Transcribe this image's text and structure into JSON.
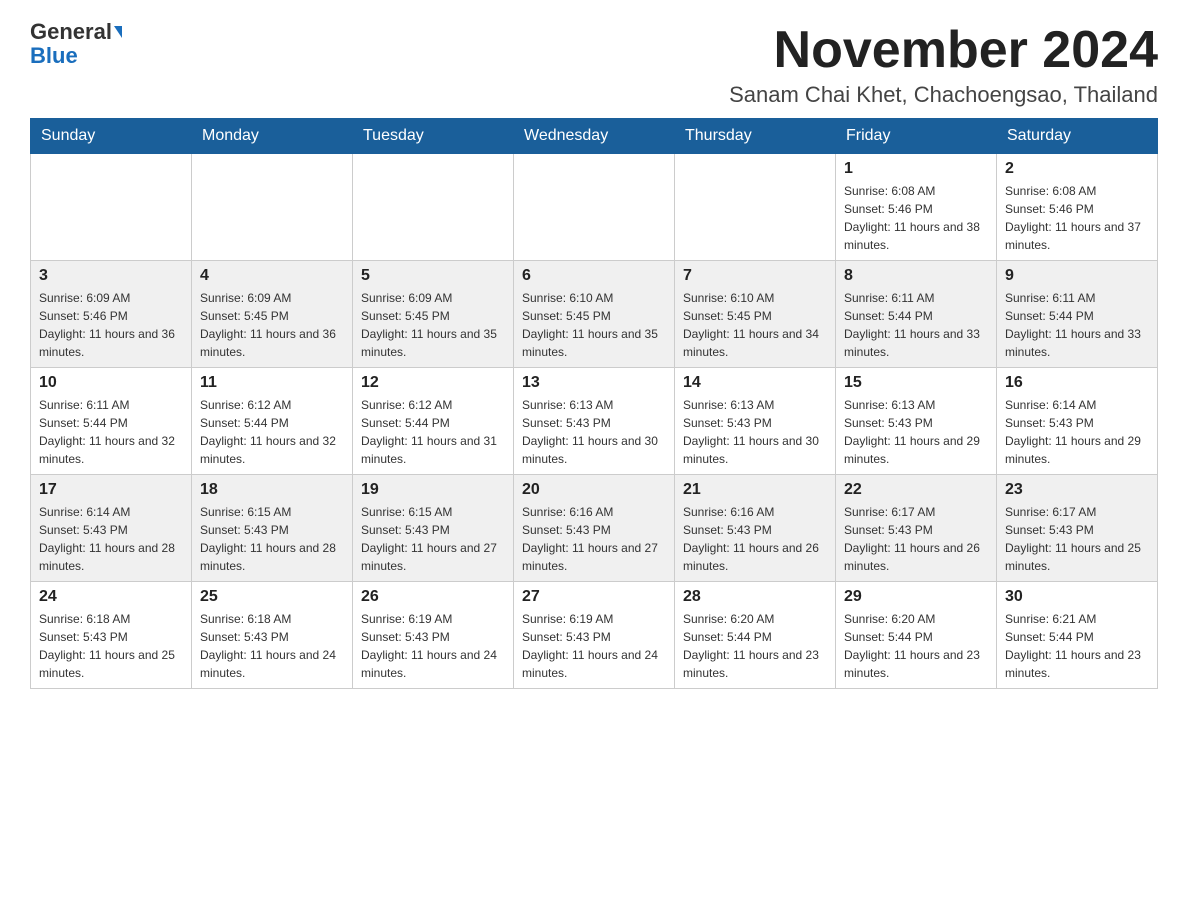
{
  "header": {
    "logo_general": "General",
    "logo_blue": "Blue",
    "month_title": "November 2024",
    "location": "Sanam Chai Khet, Chachoengsao, Thailand"
  },
  "days_of_week": [
    "Sunday",
    "Monday",
    "Tuesday",
    "Wednesday",
    "Thursday",
    "Friday",
    "Saturday"
  ],
  "weeks": [
    [
      {
        "day": "",
        "info": ""
      },
      {
        "day": "",
        "info": ""
      },
      {
        "day": "",
        "info": ""
      },
      {
        "day": "",
        "info": ""
      },
      {
        "day": "",
        "info": ""
      },
      {
        "day": "1",
        "info": "Sunrise: 6:08 AM\nSunset: 5:46 PM\nDaylight: 11 hours and 38 minutes."
      },
      {
        "day": "2",
        "info": "Sunrise: 6:08 AM\nSunset: 5:46 PM\nDaylight: 11 hours and 37 minutes."
      }
    ],
    [
      {
        "day": "3",
        "info": "Sunrise: 6:09 AM\nSunset: 5:46 PM\nDaylight: 11 hours and 36 minutes."
      },
      {
        "day": "4",
        "info": "Sunrise: 6:09 AM\nSunset: 5:45 PM\nDaylight: 11 hours and 36 minutes."
      },
      {
        "day": "5",
        "info": "Sunrise: 6:09 AM\nSunset: 5:45 PM\nDaylight: 11 hours and 35 minutes."
      },
      {
        "day": "6",
        "info": "Sunrise: 6:10 AM\nSunset: 5:45 PM\nDaylight: 11 hours and 35 minutes."
      },
      {
        "day": "7",
        "info": "Sunrise: 6:10 AM\nSunset: 5:45 PM\nDaylight: 11 hours and 34 minutes."
      },
      {
        "day": "8",
        "info": "Sunrise: 6:11 AM\nSunset: 5:44 PM\nDaylight: 11 hours and 33 minutes."
      },
      {
        "day": "9",
        "info": "Sunrise: 6:11 AM\nSunset: 5:44 PM\nDaylight: 11 hours and 33 minutes."
      }
    ],
    [
      {
        "day": "10",
        "info": "Sunrise: 6:11 AM\nSunset: 5:44 PM\nDaylight: 11 hours and 32 minutes."
      },
      {
        "day": "11",
        "info": "Sunrise: 6:12 AM\nSunset: 5:44 PM\nDaylight: 11 hours and 32 minutes."
      },
      {
        "day": "12",
        "info": "Sunrise: 6:12 AM\nSunset: 5:44 PM\nDaylight: 11 hours and 31 minutes."
      },
      {
        "day": "13",
        "info": "Sunrise: 6:13 AM\nSunset: 5:43 PM\nDaylight: 11 hours and 30 minutes."
      },
      {
        "day": "14",
        "info": "Sunrise: 6:13 AM\nSunset: 5:43 PM\nDaylight: 11 hours and 30 minutes."
      },
      {
        "day": "15",
        "info": "Sunrise: 6:13 AM\nSunset: 5:43 PM\nDaylight: 11 hours and 29 minutes."
      },
      {
        "day": "16",
        "info": "Sunrise: 6:14 AM\nSunset: 5:43 PM\nDaylight: 11 hours and 29 minutes."
      }
    ],
    [
      {
        "day": "17",
        "info": "Sunrise: 6:14 AM\nSunset: 5:43 PM\nDaylight: 11 hours and 28 minutes."
      },
      {
        "day": "18",
        "info": "Sunrise: 6:15 AM\nSunset: 5:43 PM\nDaylight: 11 hours and 28 minutes."
      },
      {
        "day": "19",
        "info": "Sunrise: 6:15 AM\nSunset: 5:43 PM\nDaylight: 11 hours and 27 minutes."
      },
      {
        "day": "20",
        "info": "Sunrise: 6:16 AM\nSunset: 5:43 PM\nDaylight: 11 hours and 27 minutes."
      },
      {
        "day": "21",
        "info": "Sunrise: 6:16 AM\nSunset: 5:43 PM\nDaylight: 11 hours and 26 minutes."
      },
      {
        "day": "22",
        "info": "Sunrise: 6:17 AM\nSunset: 5:43 PM\nDaylight: 11 hours and 26 minutes."
      },
      {
        "day": "23",
        "info": "Sunrise: 6:17 AM\nSunset: 5:43 PM\nDaylight: 11 hours and 25 minutes."
      }
    ],
    [
      {
        "day": "24",
        "info": "Sunrise: 6:18 AM\nSunset: 5:43 PM\nDaylight: 11 hours and 25 minutes."
      },
      {
        "day": "25",
        "info": "Sunrise: 6:18 AM\nSunset: 5:43 PM\nDaylight: 11 hours and 24 minutes."
      },
      {
        "day": "26",
        "info": "Sunrise: 6:19 AM\nSunset: 5:43 PM\nDaylight: 11 hours and 24 minutes."
      },
      {
        "day": "27",
        "info": "Sunrise: 6:19 AM\nSunset: 5:43 PM\nDaylight: 11 hours and 24 minutes."
      },
      {
        "day": "28",
        "info": "Sunrise: 6:20 AM\nSunset: 5:44 PM\nDaylight: 11 hours and 23 minutes."
      },
      {
        "day": "29",
        "info": "Sunrise: 6:20 AM\nSunset: 5:44 PM\nDaylight: 11 hours and 23 minutes."
      },
      {
        "day": "30",
        "info": "Sunrise: 6:21 AM\nSunset: 5:44 PM\nDaylight: 11 hours and 23 minutes."
      }
    ]
  ]
}
